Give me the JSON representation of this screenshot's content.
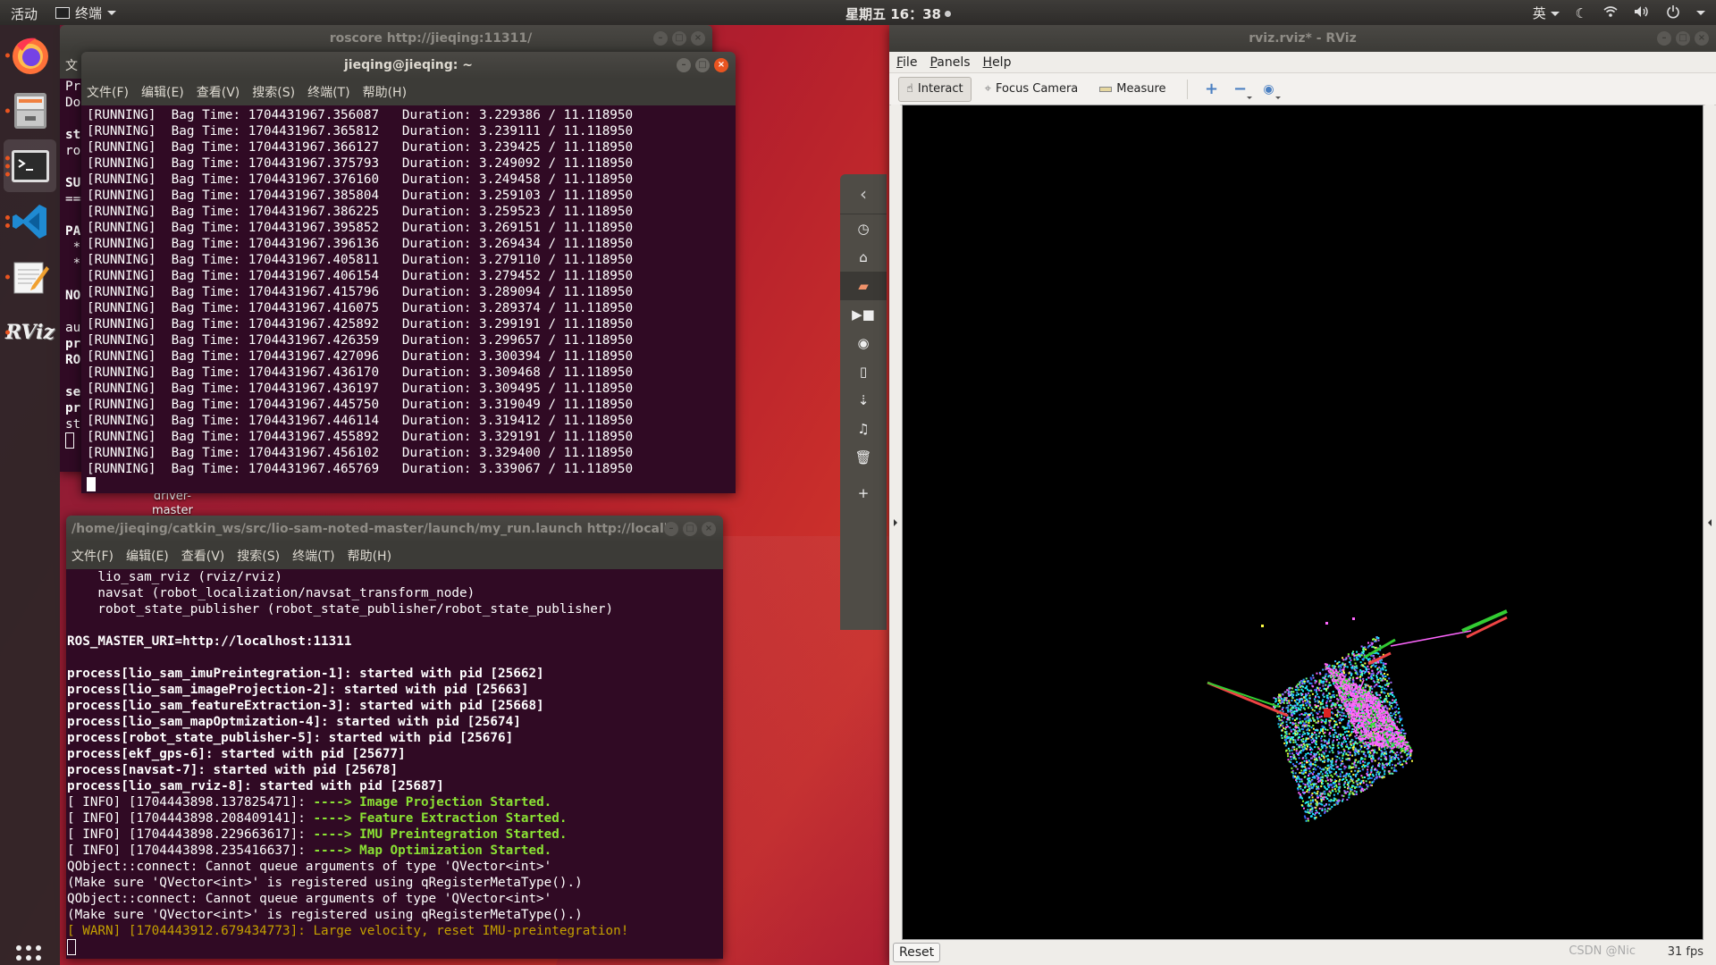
{
  "topbar": {
    "activities": "活动",
    "app_name": "终端",
    "clock": "星期五 16：38",
    "input_method": "英"
  },
  "dock": {
    "items": [
      {
        "name": "firefox",
        "icon": "firefox-icon"
      },
      {
        "name": "files",
        "icon": "file-cabinet-icon"
      },
      {
        "name": "terminal",
        "icon": "terminal-icon",
        "active": true
      },
      {
        "name": "vscode",
        "icon": "vscode-icon"
      },
      {
        "name": "text-editor",
        "icon": "notepad-pencil-icon"
      },
      {
        "name": "rviz",
        "icon": "rviz-logo-icon",
        "label": "RViz"
      }
    ]
  },
  "desktop_icon": {
    "label_line1": "driver-",
    "label_line2": "master"
  },
  "roscore_window": {
    "title": "roscore http://jieqing:11311/",
    "menu_first": "文",
    "lines": [
      "Pre",
      "Dor",
      "",
      "sta",
      "ros",
      "",
      "SUN",
      "===",
      "",
      "PAF",
      " *",
      " *",
      "",
      "NOD",
      "",
      "aut",
      "pro",
      "ROS",
      "",
      "set",
      "pro",
      "sta"
    ]
  },
  "jieqing_terminal": {
    "title": "jieqing@jieqing: ~",
    "menu": [
      "文件(F)",
      "编辑(E)",
      "查看(V)",
      "搜索(S)",
      "终端(T)",
      "帮助(H)"
    ],
    "rows": [
      {
        "status": "[RUNNING]",
        "bag_time": "1704431967.356087",
        "duration": "3.229386",
        "total": "11.118950"
      },
      {
        "status": "[RUNNING]",
        "bag_time": "1704431967.365812",
        "duration": "3.239111",
        "total": "11.118950"
      },
      {
        "status": "[RUNNING]",
        "bag_time": "1704431967.366127",
        "duration": "3.239425",
        "total": "11.118950"
      },
      {
        "status": "[RUNNING]",
        "bag_time": "1704431967.375793",
        "duration": "3.249092",
        "total": "11.118950"
      },
      {
        "status": "[RUNNING]",
        "bag_time": "1704431967.376160",
        "duration": "3.249458",
        "total": "11.118950"
      },
      {
        "status": "[RUNNING]",
        "bag_time": "1704431967.385804",
        "duration": "3.259103",
        "total": "11.118950"
      },
      {
        "status": "[RUNNING]",
        "bag_time": "1704431967.386225",
        "duration": "3.259523",
        "total": "11.118950"
      },
      {
        "status": "[RUNNING]",
        "bag_time": "1704431967.395852",
        "duration": "3.269151",
        "total": "11.118950"
      },
      {
        "status": "[RUNNING]",
        "bag_time": "1704431967.396136",
        "duration": "3.269434",
        "total": "11.118950"
      },
      {
        "status": "[RUNNING]",
        "bag_time": "1704431967.405811",
        "duration": "3.279110",
        "total": "11.118950"
      },
      {
        "status": "[RUNNING]",
        "bag_time": "1704431967.406154",
        "duration": "3.279452",
        "total": "11.118950"
      },
      {
        "status": "[RUNNING]",
        "bag_time": "1704431967.415796",
        "duration": "3.289094",
        "total": "11.118950"
      },
      {
        "status": "[RUNNING]",
        "bag_time": "1704431967.416075",
        "duration": "3.289374",
        "total": "11.118950"
      },
      {
        "status": "[RUNNING]",
        "bag_time": "1704431967.425892",
        "duration": "3.299191",
        "total": "11.118950"
      },
      {
        "status": "[RUNNING]",
        "bag_time": "1704431967.426359",
        "duration": "3.299657",
        "total": "11.118950"
      },
      {
        "status": "[RUNNING]",
        "bag_time": "1704431967.427096",
        "duration": "3.300394",
        "total": "11.118950"
      },
      {
        "status": "[RUNNING]",
        "bag_time": "1704431967.436170",
        "duration": "3.309468",
        "total": "11.118950"
      },
      {
        "status": "[RUNNING]",
        "bag_time": "1704431967.436197",
        "duration": "3.309495",
        "total": "11.118950"
      },
      {
        "status": "[RUNNING]",
        "bag_time": "1704431967.445750",
        "duration": "3.319049",
        "total": "11.118950"
      },
      {
        "status": "[RUNNING]",
        "bag_time": "1704431967.446114",
        "duration": "3.319412",
        "total": "11.118950"
      },
      {
        "status": "[RUNNING]",
        "bag_time": "1704431967.455892",
        "duration": "3.329191",
        "total": "11.118950"
      },
      {
        "status": "[RUNNING]",
        "bag_time": "1704431967.456102",
        "duration": "3.329400",
        "total": "11.118950"
      },
      {
        "status": "[RUNNING]",
        "bag_time": "1704431967.465769",
        "duration": "3.339067",
        "total": "11.118950"
      }
    ],
    "bag_time_label": "Bag Time:",
    "duration_label": "Duration:"
  },
  "launch_terminal": {
    "title": "/home/jieqing/catkin_ws/src/lio-sam-noted-master/launch/my_run.launch http://localhost:...",
    "menu": [
      "文件(F)",
      "编辑(E)",
      "查看(V)",
      "搜索(S)",
      "终端(T)",
      "帮助(H)"
    ],
    "lines": [
      {
        "text": "    lio_sam_rviz (rviz/rviz)",
        "style": "normal"
      },
      {
        "text": "    navsat (robot_localization/navsat_transform_node)",
        "style": "normal"
      },
      {
        "text": "    robot_state_publisher (robot_state_publisher/robot_state_publisher)",
        "style": "normal"
      },
      {
        "text": "",
        "style": "normal"
      },
      {
        "text": "ROS_MASTER_URI=http://localhost:11311",
        "style": "bold"
      },
      {
        "text": "",
        "style": "normal"
      },
      {
        "text": "process[lio_sam_imuPreintegration-1]: started with pid [25662]",
        "style": "bold"
      },
      {
        "text": "process[lio_sam_imageProjection-2]: started with pid [25663]",
        "style": "bold"
      },
      {
        "text": "process[lio_sam_featureExtraction-3]: started with pid [25668]",
        "style": "bold"
      },
      {
        "text": "process[lio_sam_mapOptmization-4]: started with pid [25674]",
        "style": "bold"
      },
      {
        "text": "process[robot_state_publisher-5]: started with pid [25676]",
        "style": "bold"
      },
      {
        "text": "process[ekf_gps-6]: started with pid [25677]",
        "style": "bold"
      },
      {
        "text": "process[navsat-7]: started with pid [25678]",
        "style": "bold"
      },
      {
        "text": "process[lio_sam_rviz-8]: started with pid [25687]",
        "style": "bold"
      },
      {
        "text": "[ INFO] [1704443898.137825471]: ",
        "suffix": "----> Image Projection Started.",
        "style": "info"
      },
      {
        "text": "[ INFO] [1704443898.208409141]: ",
        "suffix": "----> Feature Extraction Started.",
        "style": "info"
      },
      {
        "text": "[ INFO] [1704443898.229663617]: ",
        "suffix": "----> IMU Preintegration Started.",
        "style": "info"
      },
      {
        "text": "[ INFO] [1704443898.235416637]: ",
        "suffix": "----> Map Optimization Started.",
        "style": "info"
      },
      {
        "text": "QObject::connect: Cannot queue arguments of type 'QVector<int>'",
        "style": "normal"
      },
      {
        "text": "(Make sure 'QVector<int>' is registered using qRegisterMetaType().)",
        "style": "normal"
      },
      {
        "text": "QObject::connect: Cannot queue arguments of type 'QVector<int>'",
        "style": "normal"
      },
      {
        "text": "(Make sure 'QVector<int>' is registered using qRegisterMetaType().)",
        "style": "normal"
      },
      {
        "text": "[ WARN] [1704443912.679434773]: Large velocity, reset IMU-preintegration!",
        "style": "warn"
      }
    ]
  },
  "file_panel": {
    "icons": [
      "recent-icon",
      "home-icon",
      "folder-icon",
      "video-icon",
      "camera-icon",
      "document-icon",
      "download-icon",
      "music-icon",
      "trash-icon",
      "plus-icon"
    ],
    "selected": "folder-icon"
  },
  "rviz": {
    "title": "rviz.rviz* - RViz",
    "menu": [
      {
        "u": "F",
        "rest": "ile"
      },
      {
        "u": "P",
        "rest": "anels"
      },
      {
        "u": "H",
        "rest": "elp"
      }
    ],
    "tools": {
      "interact": "Interact",
      "focus": "Focus Camera",
      "measure": "Measure"
    },
    "reset_label": "Reset",
    "fps": "31 fps"
  },
  "watermark": "CSDN @Nic"
}
